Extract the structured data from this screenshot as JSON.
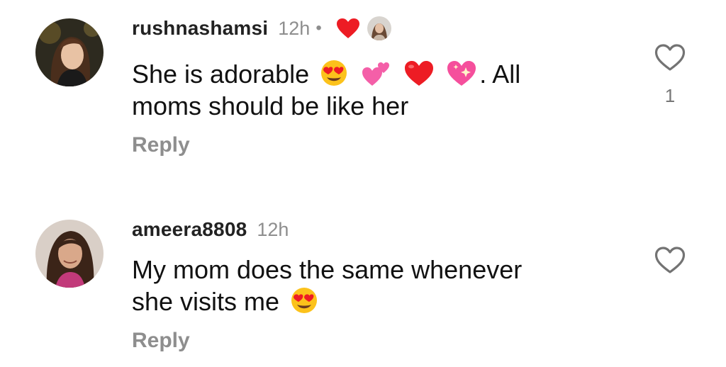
{
  "comments": [
    {
      "username": "rushnashamsi",
      "time": "12h",
      "dot": "•",
      "text_parts": [
        "She is adorable",
        ". All",
        "moms should be like her"
      ],
      "emojis": [
        "heart-eyes-face",
        "two-hearts",
        "red-heart",
        "sparkling-heart"
      ],
      "liked_by_author": true,
      "reply_label": "Reply",
      "like_count": "1"
    },
    {
      "username": "ameera8808",
      "time": "12h",
      "text_parts": [
        "My mom does the same whenever",
        "she visits me"
      ],
      "emojis": [
        "heart-eyes-face"
      ],
      "reply_label": "Reply"
    }
  ],
  "colors": {
    "username": "#222222",
    "muted": "#8e8e8e",
    "text": "#111111",
    "heart_red": "#ed1c24"
  }
}
